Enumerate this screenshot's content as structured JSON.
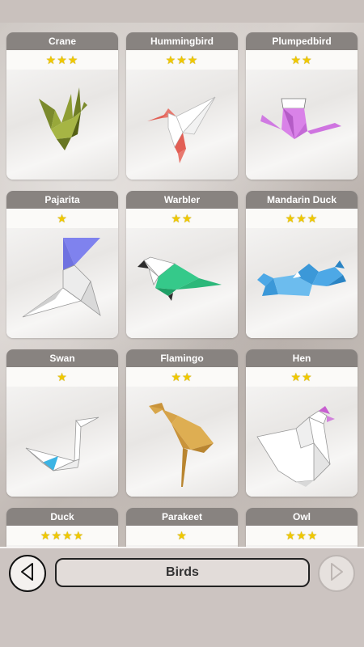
{
  "items": [
    {
      "name": "Crane",
      "stars": "★★★"
    },
    {
      "name": "Hummingbird",
      "stars": "★★★"
    },
    {
      "name": "Plumpedbird",
      "stars": "★★"
    },
    {
      "name": "Pajarita",
      "stars": "★"
    },
    {
      "name": "Warbler",
      "stars": "★★"
    },
    {
      "name": "Mandarin Duck",
      "stars": "★★★"
    },
    {
      "name": "Swan",
      "stars": "★"
    },
    {
      "name": "Flamingo",
      "stars": "★★"
    },
    {
      "name": "Hen",
      "stars": "★★"
    },
    {
      "name": "Duck",
      "stars": "★★★★"
    },
    {
      "name": "Parakeet",
      "stars": "★"
    },
    {
      "name": "Owl",
      "stars": "★★★"
    }
  ],
  "bottom": {
    "category": "Birds"
  },
  "icons": {
    "prev": "triangle-left-icon",
    "next": "triangle-right-icon"
  }
}
